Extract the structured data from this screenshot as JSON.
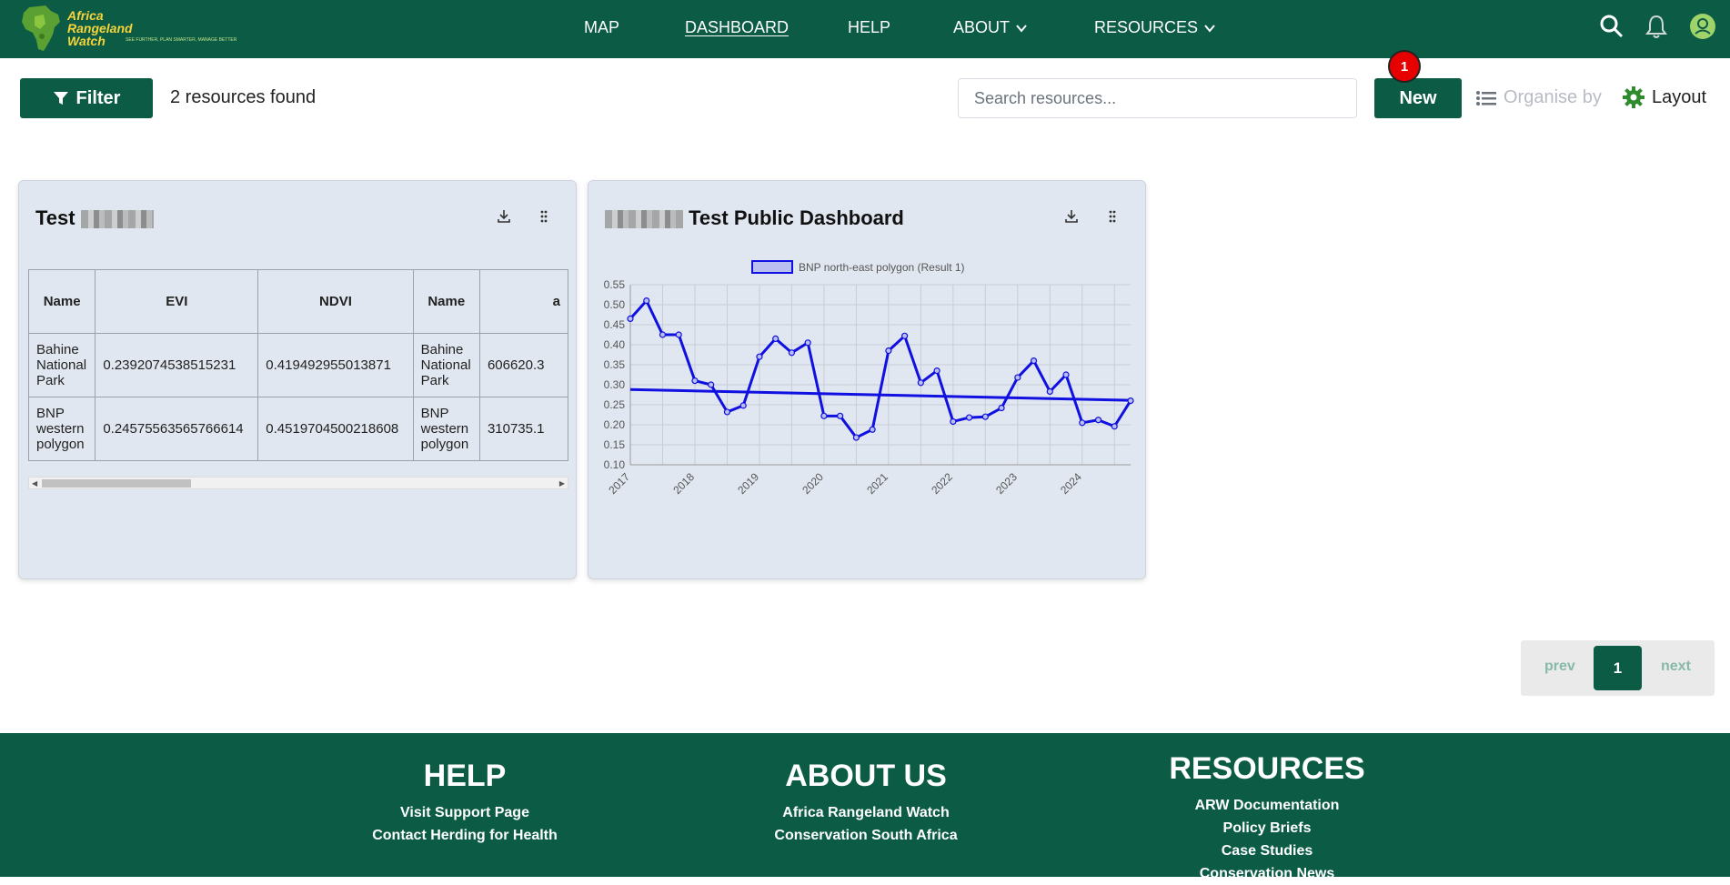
{
  "header": {
    "logo": {
      "line1": "Africa",
      "line2": "Rangeland",
      "line3": "Watch",
      "tagline": "SEE FURTHER, PLAN SMARTER, MANAGE BETTER"
    },
    "nav": {
      "map": "MAP",
      "dashboard": "DASHBOARD",
      "help": "HELP",
      "about": "ABOUT",
      "resources": "RESOURCES"
    },
    "icons": [
      "search-icon",
      "bell-icon",
      "user-icon"
    ]
  },
  "toolbar": {
    "filter_label": "Filter",
    "results_text": "2 resources found",
    "search_placeholder": "Search resources...",
    "new_label": "New",
    "new_badge": "1",
    "organise_label": "Organise by",
    "layout_label": "Layout"
  },
  "cards": [
    {
      "title": "Test",
      "table": {
        "headers": [
          "Name",
          "EVI",
          "NDVI",
          "Name",
          "a"
        ],
        "rows": [
          [
            "Bahine National Park",
            "0.2392074538515231",
            "0.419492955013871",
            "Bahine National Park",
            "606620.3"
          ],
          [
            "BNP western polygon",
            "0.24575563565766614",
            "0.4519704500218608",
            "BNP western polygon",
            "310735.1"
          ]
        ]
      }
    },
    {
      "title": "Test Public Dashboard"
    }
  ],
  "chart_data": {
    "type": "line",
    "title": "",
    "xlabel": "",
    "ylabel": "",
    "series": [
      {
        "name": "BNP north-east polygon (Result 1)",
        "color": "#1010e0",
        "values": [
          0.465,
          0.51,
          0.425,
          0.425,
          0.31,
          0.3,
          0.232,
          0.248,
          0.37,
          0.415,
          0.38,
          0.405,
          0.222,
          0.222,
          0.168,
          0.188,
          0.385,
          0.422,
          0.305,
          0.335,
          0.208,
          0.218,
          0.22,
          0.242,
          0.318,
          0.36,
          0.283,
          0.325,
          0.205,
          0.212,
          0.196,
          0.26
        ]
      }
    ],
    "trendline": {
      "start": 0.288,
      "end": 0.261
    },
    "x_ticks": [
      "2017",
      "2018",
      "2019",
      "2020",
      "2021",
      "2022",
      "2023",
      "2024"
    ],
    "y_ticks": [
      "0.55",
      "0.50",
      "0.45",
      "0.40",
      "0.35",
      "0.30",
      "0.25",
      "0.20",
      "0.15",
      "0.10"
    ],
    "ylim": [
      0.1,
      0.55
    ],
    "grid": true,
    "legend": "top"
  },
  "pagination": {
    "prev": "prev",
    "current": "1",
    "next": "next"
  },
  "footer": {
    "help": {
      "title": "HELP",
      "links": [
        "Visit Support Page",
        "Contact Herding for Health"
      ]
    },
    "about": {
      "title": "ABOUT US",
      "links": [
        "Africa Rangeland Watch",
        "Conservation South Africa"
      ]
    },
    "resources": {
      "title": "RESOURCES",
      "links": [
        "ARW Documentation",
        "Policy Briefs",
        "Case Studies",
        "Conservation News"
      ]
    }
  },
  "colors": {
    "brand": "#0b5b45",
    "accent": "#f6d43a",
    "badge": "#e60000",
    "series": "#1010e0"
  }
}
